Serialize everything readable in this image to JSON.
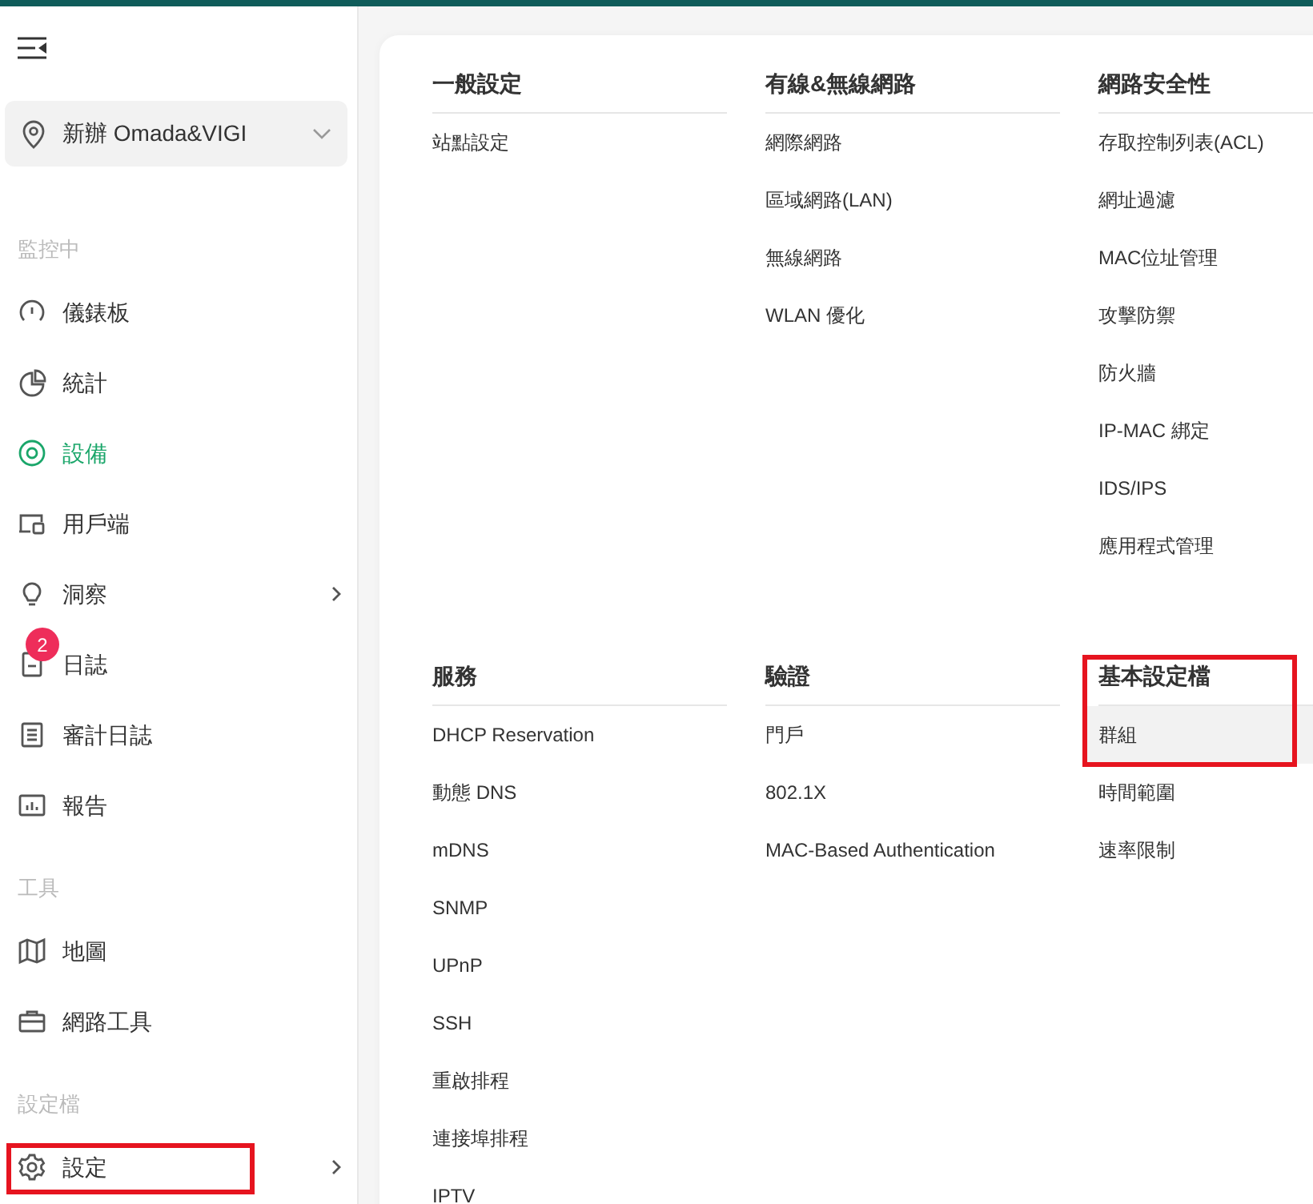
{
  "site_selector": {
    "label": "新辦 Omada&VIGI"
  },
  "sidebar": [
    {
      "label": "監控中",
      "items": [
        {
          "label": "儀錶板",
          "kind": "gauge",
          "selected": false,
          "has_submenu": false
        },
        {
          "label": "統計",
          "kind": "pie",
          "selected": false,
          "has_submenu": false
        },
        {
          "label": "設備",
          "kind": "target",
          "selected": true,
          "has_submenu": false
        },
        {
          "label": "用戶端",
          "kind": "devices",
          "selected": false,
          "has_submenu": false
        },
        {
          "label": "洞察",
          "kind": "bulb",
          "selected": false,
          "has_submenu": true
        },
        {
          "label": "日誌",
          "kind": "doc",
          "selected": false,
          "has_submenu": false,
          "badge": "2"
        },
        {
          "label": "審計日誌",
          "kind": "list",
          "selected": false,
          "has_submenu": false
        },
        {
          "label": "報告",
          "kind": "chart",
          "selected": false,
          "has_submenu": false
        }
      ]
    },
    {
      "label": "工具",
      "items": [
        {
          "label": "地圖",
          "kind": "map",
          "selected": false,
          "has_submenu": false
        },
        {
          "label": "網路工具",
          "kind": "toolbox",
          "selected": false,
          "has_submenu": false
        }
      ]
    },
    {
      "label": "設定檔",
      "items": [
        {
          "label": "設定",
          "kind": "gear",
          "selected": false,
          "has_submenu": true,
          "annotated": true
        }
      ]
    }
  ],
  "sections": [
    {
      "title": "一般設定",
      "annotated": false,
      "items": [
        {
          "label": "站點設定",
          "hovered": false
        }
      ]
    },
    {
      "title": "有線&無線網路",
      "annotated": false,
      "items": [
        {
          "label": "網際網路",
          "hovered": false
        },
        {
          "label": "區域網路(LAN)",
          "hovered": false
        },
        {
          "label": "無線網路",
          "hovered": false
        },
        {
          "label": "WLAN 優化",
          "hovered": false
        }
      ]
    },
    {
      "title": "網路安全性",
      "annotated": false,
      "items": [
        {
          "label": "存取控制列表(ACL)",
          "hovered": false
        },
        {
          "label": "網址過濾",
          "hovered": false
        },
        {
          "label": "MAC位址管理",
          "hovered": false
        },
        {
          "label": "攻擊防禦",
          "hovered": false
        },
        {
          "label": "防火牆",
          "hovered": false
        },
        {
          "label": "IP-MAC 綁定",
          "hovered": false
        },
        {
          "label": "IDS/IPS",
          "hovered": false
        },
        {
          "label": "應用程式管理",
          "hovered": false
        }
      ]
    },
    {
      "title": "服務",
      "annotated": false,
      "items": [
        {
          "label": "DHCP Reservation",
          "hovered": false
        },
        {
          "label": "動態 DNS",
          "hovered": false
        },
        {
          "label": "mDNS",
          "hovered": false
        },
        {
          "label": "SNMP",
          "hovered": false
        },
        {
          "label": "UPnP",
          "hovered": false
        },
        {
          "label": "SSH",
          "hovered": false
        },
        {
          "label": "重啟排程",
          "hovered": false
        },
        {
          "label": "連接埠排程",
          "hovered": false
        },
        {
          "label": "IPTV",
          "hovered": false
        }
      ]
    },
    {
      "title": "驗證",
      "annotated": false,
      "items": [
        {
          "label": "門戶",
          "hovered": false
        },
        {
          "label": "802.1X",
          "hovered": false
        },
        {
          "label": "MAC-Based Authentication",
          "hovered": false
        }
      ]
    },
    {
      "title": "基本設定檔",
      "annotated": true,
      "items": [
        {
          "label": "群組",
          "hovered": true
        },
        {
          "label": "時間範圍",
          "hovered": false
        },
        {
          "label": "速率限制",
          "hovered": false
        }
      ]
    }
  ]
}
